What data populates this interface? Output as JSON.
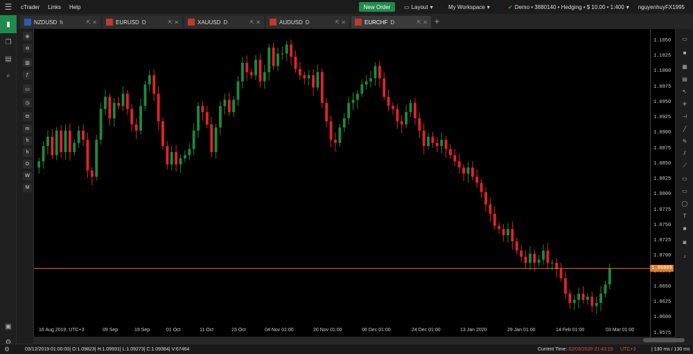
{
  "app": {
    "title": "cTrader",
    "menu": [
      "Links",
      "Help"
    ],
    "new_order": "New Order",
    "layout": "Layout",
    "workspace": "My Workspace",
    "account": "Demo • 3880140 • Hedging • $ 10.00 • 1:400",
    "user": "nguyenhuyFX1995"
  },
  "tabs": [
    {
      "symbol": "NZDUSD",
      "tf": "h",
      "tf_sub": "1"
    },
    {
      "symbol": "EURUSD",
      "tf": "D",
      "tf_sub": "1"
    },
    {
      "symbol": "XAUUSD",
      "tf": "D",
      "tf_sub": "1"
    },
    {
      "symbol": "AUDUSD",
      "tf": "D",
      "tf_sub": "1"
    },
    {
      "symbol": "EURCHF",
      "tf": "D",
      "tf_sub": "1"
    }
  ],
  "drawtools": [
    "m",
    "h",
    "h",
    "D",
    "W",
    "M"
  ],
  "chart_data": {
    "type": "candlestick",
    "symbol": "EURCHF",
    "timeframe": "D1",
    "current_price": "1.06809",
    "y_ticks": [
      "1.1050",
      "1.1025",
      "1.1000",
      "1.0975",
      "1.0950",
      "1.0925",
      "1.0900",
      "1.0875",
      "1.0850",
      "1.0825",
      "1.0800",
      "1.0775",
      "1.0750",
      "1.0725",
      "1.0700",
      "1.0675",
      "1.0650",
      "1.0625",
      "1.0600",
      "1.0575"
    ],
    "x_ticks": [
      "16 Aug 2019, UTC+3",
      "09 Sep",
      "19 Sep",
      "01 Oct",
      "11 Oct",
      "23 Oct",
      "04 Nov 01:00",
      "20 Nov 01:00",
      "06 Dec 01:00",
      "24 Dec 01:00",
      "13 Jan 2020",
      "29 Jan 01:00",
      "14 Feb 01:00",
      "03 Mar 01:00"
    ],
    "ylim": [
      1.057,
      1.107
    ],
    "colors": {
      "up": "#1e8a3c",
      "down": "#e0242a",
      "price_line": "#e07b2a"
    },
    "closes": [
      1.0855,
      1.088,
      1.0895,
      1.0865,
      1.0905,
      1.087,
      1.0905,
      1.087,
      1.0885,
      1.0905,
      1.089,
      1.084,
      1.083,
      1.089,
      1.094,
      1.096,
      1.0925,
      1.095,
      1.0945,
      1.0965,
      1.094,
      1.0915,
      1.0905,
      1.0945,
      1.098,
      1.0995,
      1.0965,
      1.092,
      1.088,
      1.085,
      1.087,
      1.085,
      1.086,
      1.0865,
      1.0875,
      1.0905,
      1.0945,
      1.0935,
      1.0915,
      1.087,
      1.091,
      1.0945,
      1.0955,
      1.0935,
      1.0955,
      1.0985,
      1.1015,
      1.1,
      1.0995,
      1.102,
      1.0985,
      1.1,
      1.104,
      1.101,
      1.103,
      1.103,
      1.1045,
      1.1025,
      1.1005,
      1.0995,
      1.099,
      1.0995,
      1.0975,
      1.1,
      1.095,
      1.092,
      1.089,
      1.0885,
      1.091,
      1.0925,
      1.095,
      1.0955,
      1.0965,
      1.098,
      1.0985,
      1.099,
      1.101,
      1.099,
      1.096,
      1.0945,
      1.094,
      1.092,
      1.0915,
      1.0935,
      1.095,
      1.0925,
      1.0905,
      1.088,
      1.0895,
      1.0885,
      1.088,
      1.089,
      1.0875,
      1.0865,
      1.0855,
      1.0845,
      1.0835,
      1.0845,
      1.083,
      1.082,
      1.0805,
      1.0785,
      1.077,
      1.075,
      1.0745,
      1.0735,
      1.0745,
      1.0725,
      1.071,
      1.07,
      1.069,
      1.0705,
      1.069,
      1.0695,
      1.071,
      1.069,
      1.069,
      1.068,
      1.0665,
      1.064,
      1.0625,
      1.063,
      1.064,
      1.063,
      1.0635,
      1.062,
      1.0625,
      1.064,
      1.0655,
      1.0681
    ]
  },
  "status": {
    "ohlc": "03/12/2019 01:00:00| O:1.09823| H:1.09931| L:1.09273| C:1.09384| V:67464",
    "current_time_label": "Current Time:",
    "current_time": "02/03/2020 21:43:15",
    "tz": "UTC+3",
    "latency": "| 130 ms / 130 ms"
  }
}
